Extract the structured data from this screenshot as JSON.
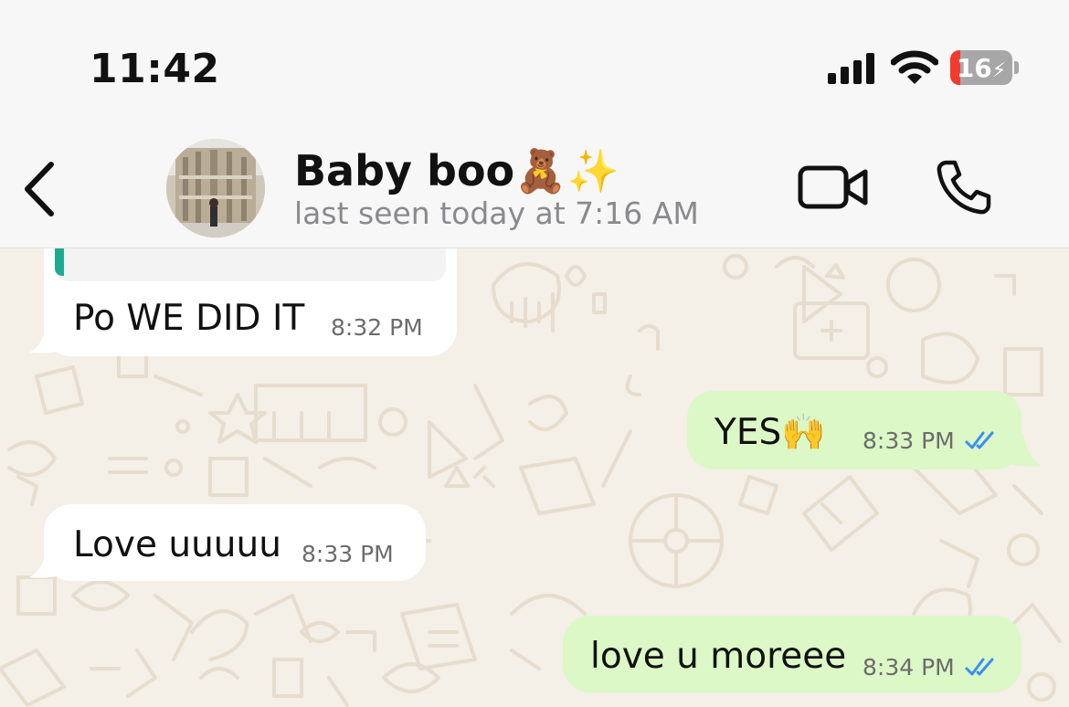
{
  "status_bar": {
    "time": "11:42",
    "battery_level": "16",
    "battery_fraction": 0.16
  },
  "header": {
    "contact_name": "Baby boo🧸✨",
    "last_seen": "last seen today at 7:16 AM"
  },
  "messages": [
    {
      "direction": "incoming",
      "text": "Po WE DID IT",
      "time": "8:32 PM"
    },
    {
      "direction": "outgoing",
      "text": "YES🙌",
      "time": "8:33 PM",
      "status": "read"
    },
    {
      "direction": "incoming",
      "text": "Love uuuuu",
      "time": "8:33 PM"
    },
    {
      "direction": "outgoing",
      "text": "love u moreee",
      "time": "8:34 PM",
      "status": "read"
    }
  ],
  "colors": {
    "incoming_bubble": "#ffffff",
    "outgoing_bubble": "#dbf8c6",
    "read_tick": "#3b8ff0",
    "quote_accent": "#1fab8f",
    "battery_low": "#f23a2f"
  }
}
